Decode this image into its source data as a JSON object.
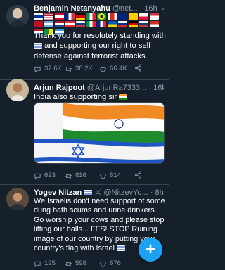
{
  "tweets": [
    {
      "name": "Benjamin Netanyahu",
      "handle": "@net...",
      "time": "16h",
      "text_line_1": "Thank you for resolutely standing with",
      "text_line_2": "and supporting our right to self",
      "text_line_3": "defense against terrorist attacks.",
      "flag_count": 27,
      "replies": "37.6K",
      "retweets": "38.2K",
      "likes": "66.4K"
    },
    {
      "name": "Arjun Rajpoot",
      "handle": "@ArjunRa7333...",
      "time": "16h",
      "text": "India also supporting sir",
      "media_alt": "Indian and Israeli flags",
      "replies": "623",
      "retweets": "816",
      "likes": "814"
    },
    {
      "name": "Yogev Nitzan",
      "handle": "@NitzevYo...",
      "time": "8h",
      "text": "We Israelis don't need support of some dung bath scums and urine drinkers. Go worship your cows and please stop lifting our balls... FFS! STOP Ruining image of our country by putting your country's flag with Israel",
      "replies": "195",
      "retweets": "598",
      "likes": "676"
    }
  ],
  "compose_button_label": "+",
  "colors": {
    "background": "#15202b",
    "accent": "#1da1f2",
    "muted": "#8899a6",
    "divider": "#38444d"
  }
}
